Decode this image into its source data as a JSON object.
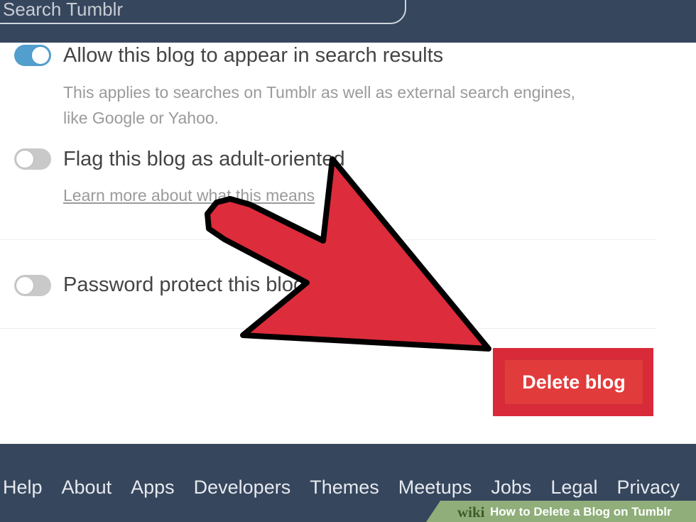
{
  "header": {
    "search_placeholder": "Search Tumblr"
  },
  "settings": {
    "search_visibility": {
      "label": "Allow this blog to appear in search results",
      "description": "This applies to searches on Tumblr as well as external search engines, like Google or Yahoo.",
      "enabled": true
    },
    "adult_flag": {
      "label": "Flag this blog as adult-oriented",
      "link_text": "Learn more about what this means",
      "enabled": false
    },
    "password_protect": {
      "label": "Password protect this blog",
      "enabled": false
    },
    "delete_button": "Delete blog"
  },
  "footer": {
    "links": [
      "Help",
      "About",
      "Apps",
      "Developers",
      "Themes",
      "Meetups",
      "Jobs",
      "Legal",
      "Privacy"
    ]
  },
  "annotation": {
    "arrow_color": "#dd2c3c"
  },
  "watermark": {
    "brand": "wiki",
    "title": "How to Delete a Blog on Tumblr"
  },
  "colors": {
    "navy": "#36465d",
    "toggle_on": "#529ecc",
    "danger": "#e23b3b"
  }
}
